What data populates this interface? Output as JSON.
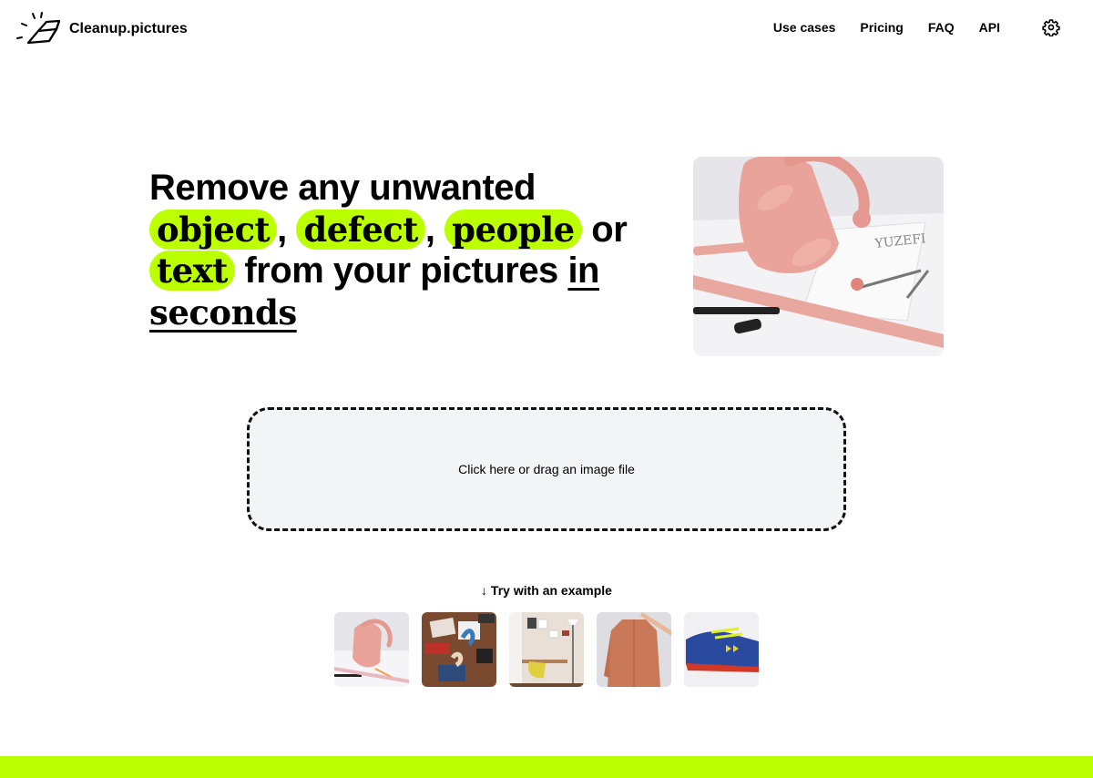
{
  "header": {
    "logo_icon": "eraser-icon",
    "brand": "Cleanup.pictures",
    "nav": [
      {
        "label": "Use cases"
      },
      {
        "label": "Pricing"
      },
      {
        "label": "FAQ"
      },
      {
        "label": "API"
      }
    ],
    "settings_icon": "gear-icon"
  },
  "hero": {
    "line1": "Remove any unwanted",
    "highlights": [
      "object",
      "defect",
      "people",
      "text"
    ],
    "sep1": ",",
    "sep2": ",",
    "or": "or",
    "from": "from your pictures",
    "in": "in",
    "seconds": "seconds",
    "image_alt": "Pink handbag on a design table with ruler, pen and compass"
  },
  "upload": {
    "label": "Click here or drag an image file"
  },
  "examples": {
    "label": "↓ Try with an example",
    "items": [
      {
        "alt": "Pink handbag"
      },
      {
        "alt": "Desk with stationery and stickers"
      },
      {
        "alt": "Room with yellow chair and lamp"
      },
      {
        "alt": "Orange jacket on hanger"
      },
      {
        "alt": "Blue sneaker"
      }
    ]
  },
  "colors": {
    "accent": "#bbff00",
    "dropzone_bg": "#f3f4f6",
    "text": "#000000"
  }
}
